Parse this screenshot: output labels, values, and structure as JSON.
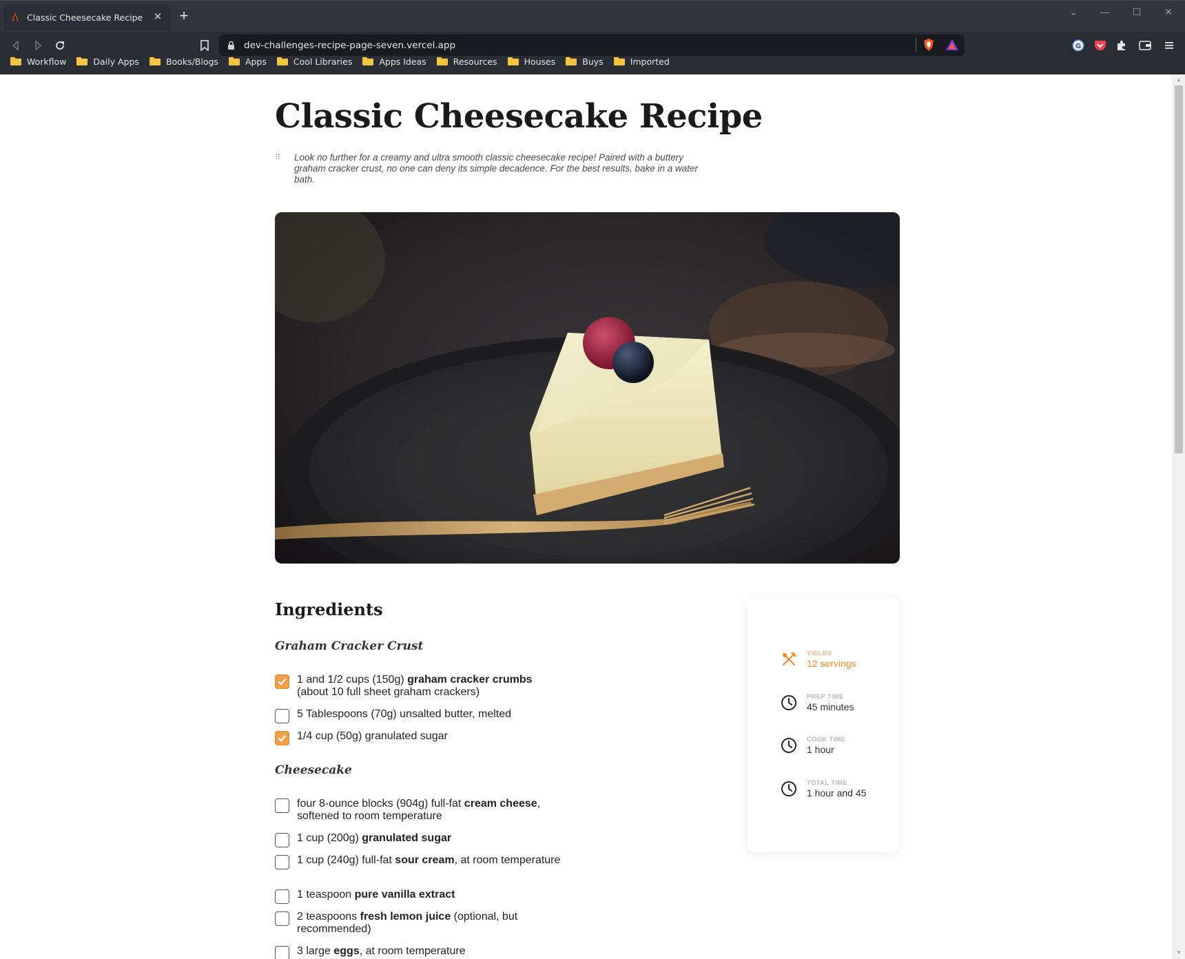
{
  "browser": {
    "tab_title": "Classic Cheesecake Recipe",
    "url": "dev-challenges-recipe-page-seven.vercel.app",
    "bookmarks": [
      "Workflow",
      "Daily Apps",
      "Books/Blogs",
      "Apps",
      "Cool Libraries",
      "Apps Ideas",
      "Resources",
      "Houses",
      "Buys",
      "Imported"
    ]
  },
  "recipe": {
    "title": "Classic Cheesecake Recipe",
    "intro": "Look no further for a creamy and ultra smooth classic cheesecake recipe! Paired with a buttery graham cracker crust, no one can deny its simple decadence. For the best results, bake in a water bath.",
    "ingredients_heading": "Ingredients",
    "sections": [
      {
        "title": "Graham Cracker Crust",
        "items": [
          {
            "pre": "1 and 1/2 cups (150g) ",
            "bold": "graham cracker crumbs",
            "post": " (about 10 full sheet graham crackers)",
            "checked": true
          },
          {
            "pre": "5 Tablespoons (70g) unsalted butter, melted",
            "bold": "",
            "post": "",
            "checked": false
          },
          {
            "pre": "1/4 cup (50g) granulated sugar",
            "bold": "",
            "post": "",
            "checked": true
          }
        ]
      },
      {
        "title": "Cheesecake",
        "items": [
          {
            "pre": "four 8-ounce blocks (904g) full-fat ",
            "bold": "cream cheese",
            "post": ", softened to room temperature",
            "checked": false
          },
          {
            "pre": "1 cup (200g) ",
            "bold": "granulated sugar",
            "post": "",
            "checked": false
          },
          {
            "pre": "1 cup (240g) full-fat ",
            "bold": "sour cream",
            "post": ", at room temperature",
            "checked": false
          },
          {
            "pre": "1 teaspoon ",
            "bold": "pure vanilla extract",
            "post": "",
            "checked": false
          },
          {
            "pre": "2 teaspoons ",
            "bold": "fresh lemon juice",
            "post": " (optional, but recommended)",
            "checked": false
          },
          {
            "pre": "3 large ",
            "bold": "eggs",
            "post": ", at room temperature",
            "checked": false
          }
        ]
      }
    ],
    "stats": [
      {
        "label": "YIELDS",
        "value": "12 servings",
        "icon": "utensils-icon"
      },
      {
        "label": "PREP TIME",
        "value": "45 minutes",
        "icon": "clock-icon"
      },
      {
        "label": "COOK TIME",
        "value": "1 hour",
        "icon": "clock-icon"
      },
      {
        "label": "TOTAL TIME",
        "value": "1 hour and 45",
        "icon": "clock-icon"
      }
    ]
  },
  "colors": {
    "accent": "#ef8c2f",
    "checkbox_checked": "#f0a04b"
  }
}
